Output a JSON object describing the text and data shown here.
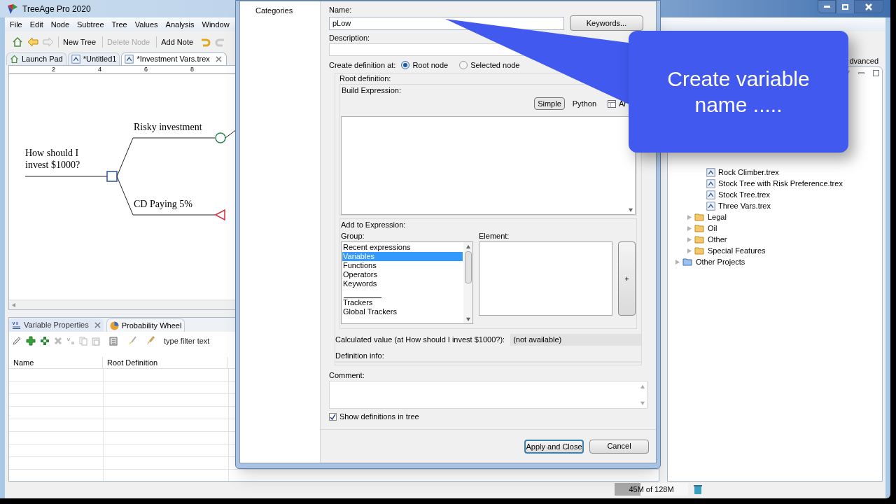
{
  "window": {
    "title": "TreeAge Pro 2020"
  },
  "menu": [
    "File",
    "Edit",
    "Node",
    "Subtree",
    "Tree",
    "Values",
    "Analysis",
    "Window"
  ],
  "toolbar": [
    {
      "kind": "home",
      "disabled": false
    },
    {
      "kind": "back",
      "disabled": false
    },
    {
      "kind": "forward",
      "disabled": true
    },
    {
      "kind": "text",
      "label": "New Tree",
      "disabled": false
    },
    {
      "kind": "text",
      "label": "Delete Node",
      "disabled": true
    },
    {
      "kind": "text",
      "label": "Add Note",
      "disabled": false
    },
    {
      "kind": "undo",
      "disabled": false
    },
    {
      "kind": "redo",
      "disabled": true
    }
  ],
  "editor_tabs": [
    {
      "label": "Launch Pad",
      "kind": "home",
      "selected": false
    },
    {
      "label": "*Untitled1",
      "kind": "tree",
      "selected": false
    },
    {
      "label": "*Investment Vars.trex",
      "kind": "tree",
      "selected": true
    }
  ],
  "ruler": [
    "2",
    "4",
    "6",
    "8"
  ],
  "tree": {
    "label": "How should I invest $1000?",
    "kind": "decision",
    "branches": [
      {
        "label": "Risky investment",
        "kind": "chance"
      },
      {
        "label": "CD Paying 5%",
        "kind": "terminal"
      }
    ]
  },
  "bottom_tabs": [
    {
      "label": "Variable Properties",
      "selected": true
    },
    {
      "label": "Probability Wheel",
      "selected": false
    }
  ],
  "filter": {
    "placeholder": "type filter text"
  },
  "table": {
    "columns": [
      "Name",
      "Root Definition"
    ]
  },
  "memory": {
    "text": "45M of 128M",
    "level": 0.35
  },
  "right_pane": {
    "tab": "dvanced",
    "tree": [
      {
        "children": [
          {
            "children": [
              {
                "label": "Rock Climber.trex",
                "kind": "file"
              },
              {
                "label": "Stock Tree with Risk Preference.trex",
                "kind": "file"
              },
              {
                "label": "Stock Tree.trex",
                "kind": "file"
              },
              {
                "label": "Three Vars.trex",
                "kind": "file"
              }
            ]
          },
          {
            "label": "Legal",
            "kind": "folder"
          },
          {
            "label": "Oil",
            "kind": "folder"
          },
          {
            "label": "Other",
            "kind": "folder"
          },
          {
            "label": "Special Features",
            "kind": "folder"
          }
        ]
      },
      {
        "label": "Other Projects",
        "kind": "project"
      }
    ]
  },
  "dialog": {
    "categories": [
      "Categories"
    ],
    "name_label": "Name:",
    "name": "pLow",
    "keywords_button": "Keywords...",
    "description_label": "Description:",
    "create_at_label": "Create definition at:",
    "create_at": [
      {
        "label": "Root node",
        "selected": true
      },
      {
        "label": "Selected node",
        "selected": false
      }
    ],
    "root_definition_label": "Root definition:",
    "build_expression_label": "Build Expression:",
    "modes": [
      {
        "label": "Simple",
        "kind": "text",
        "selected": true
      },
      {
        "label": "Python",
        "kind": "text",
        "selected": false
      },
      {
        "label": "Ar",
        "kind": "table",
        "selected": false
      }
    ],
    "add_label": "Add to Expression:",
    "group_label": "Group:",
    "groups": [
      {
        "kind": "item",
        "label": "Recent expressions",
        "selected": false
      },
      {
        "kind": "item",
        "label": "Variables",
        "selected": true
      },
      {
        "kind": "item",
        "label": "Functions",
        "selected": false
      },
      {
        "kind": "item",
        "label": "Operators",
        "selected": false
      },
      {
        "kind": "item",
        "label": "Keywords",
        "selected": false
      },
      {
        "kind": "separator"
      },
      {
        "kind": "item",
        "label": "Trackers",
        "selected": false
      },
      {
        "kind": "item",
        "label": "Global Trackers",
        "selected": false
      }
    ],
    "element_label": "Element:",
    "plus_button": "+",
    "calculated_label": "Calculated value (at How should I invest $1000?):",
    "calculated_value": "(not available)",
    "definition_info_label": "Definition info:",
    "comment_label": "Comment:",
    "show_definitions": {
      "label": "Show definitions in tree",
      "checked": true
    },
    "buttons": [
      {
        "label": "Apply and Close",
        "default": true
      },
      {
        "label": "Cancel",
        "default": false
      }
    ]
  },
  "callout": {
    "text": "Create variable name ....."
  }
}
